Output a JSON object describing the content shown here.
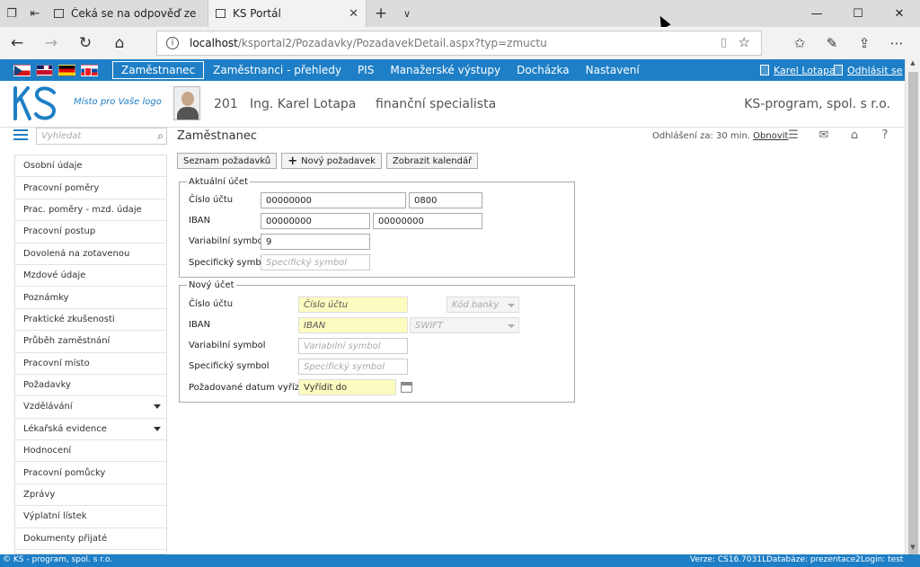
{
  "browser": {
    "tabs": [
      {
        "title": "Čeká se na odpověď ze serv",
        "active": false
      },
      {
        "title": "KS Portál",
        "active": true
      }
    ],
    "address": {
      "host": "localhost",
      "path": "/ksportal2/Pozadavky/PozadavekDetail.aspx?typ=zmuctu"
    },
    "icons": [
      "tab-preview-icon",
      "tab-back-icon",
      "back-icon",
      "forward-icon",
      "refresh-icon",
      "home-icon",
      "info-icon",
      "reading-view-icon",
      "favorite-star-icon",
      "favorites-icon",
      "pen-icon",
      "share-icon",
      "more-icon",
      "minimize-icon",
      "maximize-icon",
      "close-icon"
    ]
  },
  "appnav": {
    "languages": [
      "cz-flag",
      "uk-flag",
      "de-flag",
      "sk-flag"
    ],
    "menu": [
      "Zaměstnanec",
      "Zaměstnanci - přehledy",
      "PIS",
      "Manažerské výstupy",
      "Docházka",
      "Nastavení"
    ],
    "active_menu": "Zaměstnanec",
    "user": "Karel Lotapa",
    "logout": "Odhlásit se",
    "color": "#1e7fc6"
  },
  "header": {
    "logo_caption": "Místo pro Vaše logo",
    "emp_id": "201",
    "emp_name": "Ing. Karel Lotapa",
    "emp_role": "finanční specialista",
    "company": "KS-program, spol. s r.o."
  },
  "toolbar": {
    "search_placeholder": "Vyhledat",
    "section_title": "Zaměstnanec",
    "logout_timer": "Odhlášení za: 30 min.",
    "renew": "Obnovit"
  },
  "sidebar": {
    "items": [
      {
        "label": "Osobní údaje",
        "expandable": false
      },
      {
        "label": "Pracovní poměry",
        "expandable": false
      },
      {
        "label": "Prac. poměry - mzd. údaje",
        "expandable": false
      },
      {
        "label": "Pracovní postup",
        "expandable": false
      },
      {
        "label": "Dovolená na zotavenou",
        "expandable": false
      },
      {
        "label": "Mzdové údaje",
        "expandable": false
      },
      {
        "label": "Poznámky",
        "expandable": false
      },
      {
        "label": "Praktické zkušenosti",
        "expandable": false
      },
      {
        "label": "Průběh zaměstnání",
        "expandable": false
      },
      {
        "label": "Pracovní místo",
        "expandable": false
      },
      {
        "label": "Požadavky",
        "expandable": false
      },
      {
        "label": "Vzdělávání",
        "expandable": true
      },
      {
        "label": "Lékařská evidence",
        "expandable": true
      },
      {
        "label": "Hodnocení",
        "expandable": false
      },
      {
        "label": "Pracovní pomůcky",
        "expandable": false
      },
      {
        "label": "Zprávy",
        "expandable": false
      },
      {
        "label": "Výplatní lístek",
        "expandable": false
      },
      {
        "label": "Dokumenty přijaté",
        "expandable": false
      }
    ]
  },
  "buttons": {
    "list": "Seznam požadavků",
    "new": "Nový požadavek",
    "calendar": "Zobrazit kalendář"
  },
  "current_account": {
    "legend": "Aktuální účet",
    "account_label": "Číslo účtu",
    "account_value": "00000000",
    "bank_code_value": "0800",
    "iban_label": "IBAN",
    "iban_value_1": "00000000",
    "iban_value_2": "00000000",
    "vs_label": "Variabilní symbol",
    "vs_value": "9",
    "ss_label": "Specifický symbol",
    "ss_placeholder": "Specifický symbol"
  },
  "new_account": {
    "legend": "Nový účet",
    "account_label": "Číslo účtu",
    "account_placeholder": "Číslo účtu",
    "bank_code_placeholder": "Kód banky",
    "iban_label": "IBAN",
    "iban_placeholder": "IBAN",
    "swift_placeholder": "SWIFT",
    "vs_label": "Variabilní symbol",
    "vs_placeholder": "Variabilní symbol",
    "ss_label": "Specifický symbol",
    "ss_placeholder": "Specifický symbol",
    "date_label": "Požadované datum vyřízení",
    "date_placeholder": "Vyřídit do",
    "required_color": "#fdfcc0"
  },
  "footer": {
    "copyright": "© KS - program, spol. s r.o.",
    "version": "Verze: CS16.7031L",
    "database": "Databáze: prezentace2",
    "login": "Login: test"
  }
}
